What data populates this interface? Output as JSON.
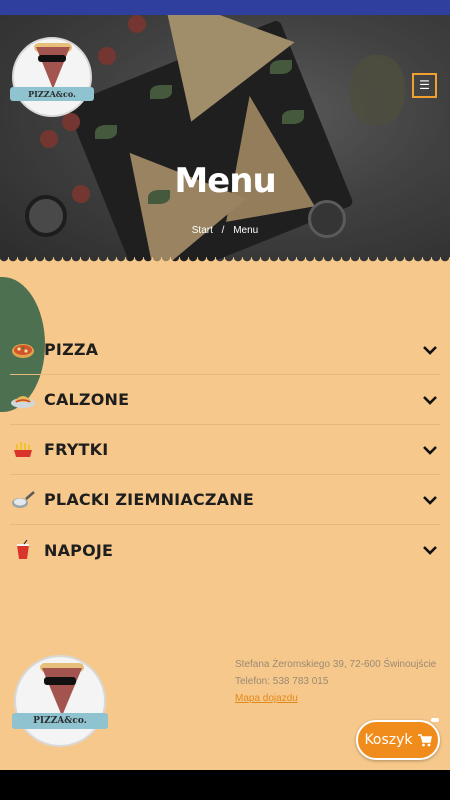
{
  "colors": {
    "top_bar": "#2f3f9e",
    "accent": "#f08c1b",
    "content_bg": "#f7c88b",
    "green_blob": "#4d7050"
  },
  "header": {
    "logo_text": "PIZZA&co.",
    "menu_icon": "hamburger-icon"
  },
  "hero": {
    "title": "Menu",
    "breadcrumb": {
      "home": "Start",
      "separator": "/",
      "current": "Menu"
    }
  },
  "categories": [
    {
      "label": "PIZZA",
      "icon": "pizza-icon"
    },
    {
      "label": "CALZONE",
      "icon": "calzone-icon"
    },
    {
      "label": "FRYTKI",
      "icon": "fries-icon"
    },
    {
      "label": "PLACKI ZIEMNIACZANE",
      "icon": "pancake-pan-icon"
    },
    {
      "label": "NAPOJE",
      "icon": "drink-cup-icon"
    }
  ],
  "footer": {
    "logo_text": "PIZZA&co.",
    "address": "Stefana Żeromskiego 39, 72-600 Świnoujście",
    "phone": "Telefon: 538 783 015",
    "map_link": "Mapa dojazdu"
  },
  "cart": {
    "label": "Koszyk",
    "icon": "cart-icon"
  }
}
